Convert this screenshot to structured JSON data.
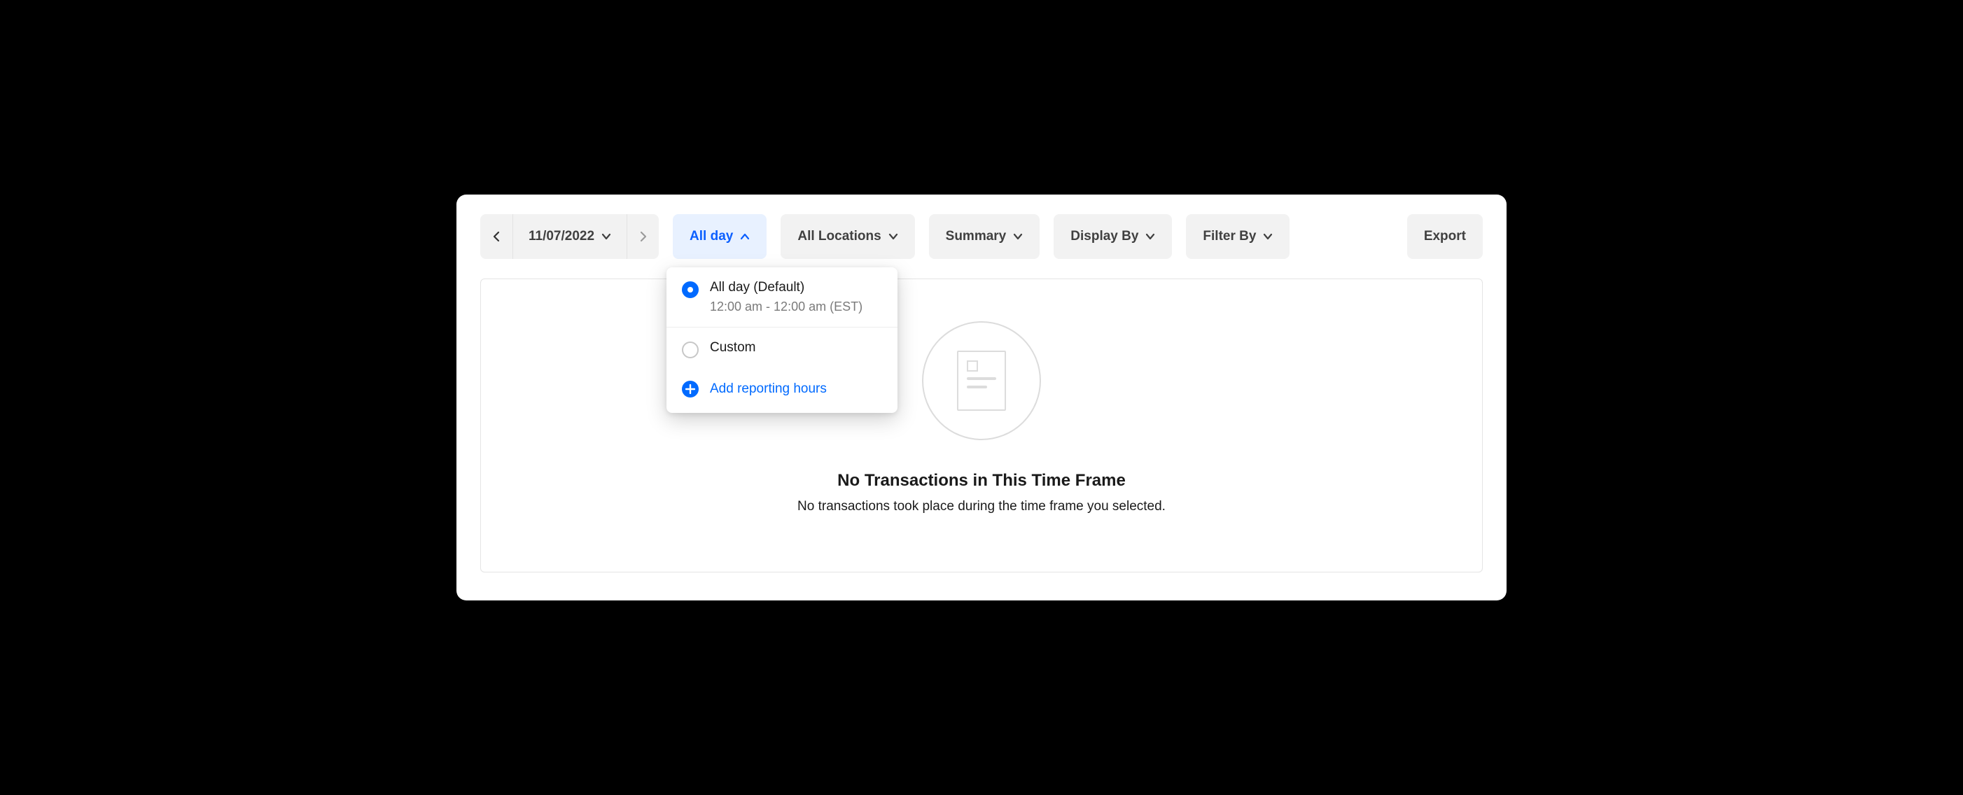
{
  "toolbar": {
    "date": "11/07/2022",
    "time_filter": {
      "label": "All day"
    },
    "locations": {
      "label": "All Locations"
    },
    "summary": {
      "label": "Summary"
    },
    "display_by": {
      "label": "Display By"
    },
    "filter_by": {
      "label": "Filter By"
    },
    "export": {
      "label": "Export"
    }
  },
  "time_dropdown": {
    "options": [
      {
        "label": "All day (Default)",
        "sub": "12:00 am - 12:00 am (EST)",
        "selected": true
      },
      {
        "label": "Custom",
        "selected": false
      }
    ],
    "add_link": "Add reporting hours"
  },
  "empty_state": {
    "title": "No Transactions in This Time Frame",
    "subtitle": "No transactions took place during the time frame you selected."
  }
}
